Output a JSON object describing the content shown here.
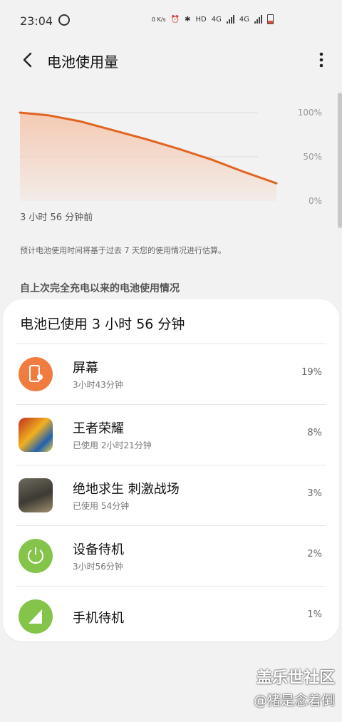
{
  "status_bar": {
    "time": "23:04",
    "net_speed": "0 K/s",
    "hd_label": "HD",
    "sim1": "4G",
    "sim2": "4G",
    "battery_color": "#e05040"
  },
  "header": {
    "title": "电池使用量"
  },
  "chart_data": {
    "type": "area",
    "x_unit": "hours ago",
    "x": [
      3.93,
      3.5,
      3.0,
      2.5,
      2.0,
      1.5,
      1.0,
      0.5,
      0.0
    ],
    "y": [
      100,
      97,
      90,
      80,
      70,
      59,
      47,
      33,
      20
    ],
    "ylim": [
      0,
      100
    ],
    "y_tick_labels": [
      "100%",
      "50%",
      "0%"
    ],
    "x_start_label": "3 小时 56 分钟前",
    "line_color": "#e06522",
    "fill_color": "#f5c8b0",
    "grid": true
  },
  "note": "预计电池使用时间将基于过去 7 天您的使用情况进行估算。",
  "section_title": "自上次完全充电以来的电池使用情况",
  "usage_card": {
    "title": "电池已使用 3 小时 56 分钟",
    "items": [
      {
        "name": "屏幕",
        "sub": "3小时43分钟",
        "percent": "19%",
        "icon": "screen-brightness-icon"
      },
      {
        "name": "王者荣耀",
        "sub": "已使用 2小时21分钟",
        "percent": "8%",
        "icon": "honor-of-kings-app-icon"
      },
      {
        "name": "绝地求生 刺激战场",
        "sub": "已使用 54分钟",
        "percent": "3%",
        "icon": "pubg-mobile-app-icon"
      },
      {
        "name": "设备待机",
        "sub": "3小时56分钟",
        "percent": "2%",
        "icon": "power-standby-icon"
      },
      {
        "name": "手机待机",
        "sub": "",
        "percent": "1%",
        "icon": "cell-signal-icon"
      }
    ]
  },
  "watermark": {
    "line1": "盖乐世社区",
    "line2": "@猪是念着倒"
  }
}
